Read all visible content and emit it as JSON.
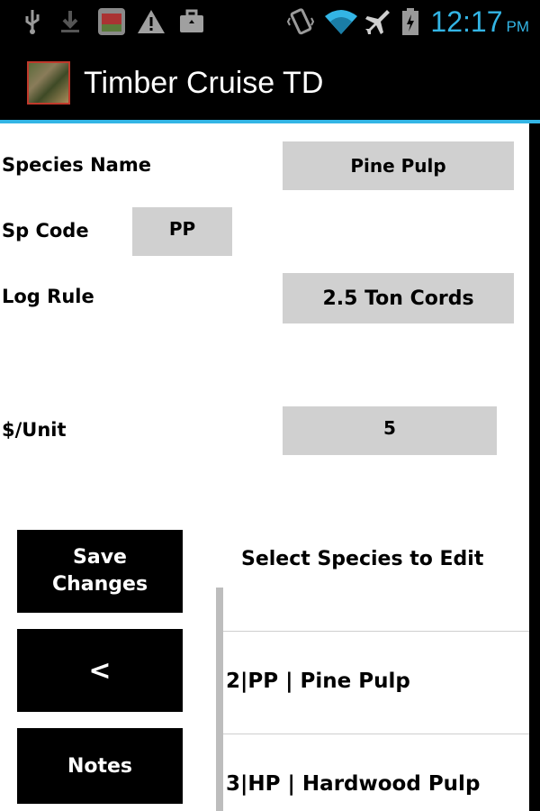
{
  "status_bar": {
    "time": "12:17",
    "ampm": "PM",
    "left_icons": [
      "usb-icon",
      "download-icon",
      "app-notification-icon",
      "warning-icon",
      "briefcase-icon"
    ],
    "right_icons": [
      "vibrate-icon",
      "wifi-icon",
      "airplane-icon",
      "battery-icon"
    ],
    "time_color": "#33b5e5"
  },
  "action_bar": {
    "title": "Timber Cruise TD",
    "accent_color": "#33b5e5"
  },
  "form": {
    "species_name_label": "Species Name",
    "species_name_value": "Pine Pulp",
    "sp_code_label": "Sp Code",
    "sp_code_value": "PP",
    "log_rule_label": "Log Rule",
    "log_rule_value": "2.5 Ton Cords",
    "unit_price_label": "$/Unit",
    "unit_price_value": "5"
  },
  "buttons": {
    "save_line1": "Save",
    "save_line2": "Changes",
    "back": "<",
    "notes": "Notes"
  },
  "species_list": {
    "header": "Select Species to Edit",
    "items": [
      {
        "label": "2|PP | Pine Pulp"
      },
      {
        "label": "3|HP | Hardwood Pulp"
      }
    ]
  }
}
